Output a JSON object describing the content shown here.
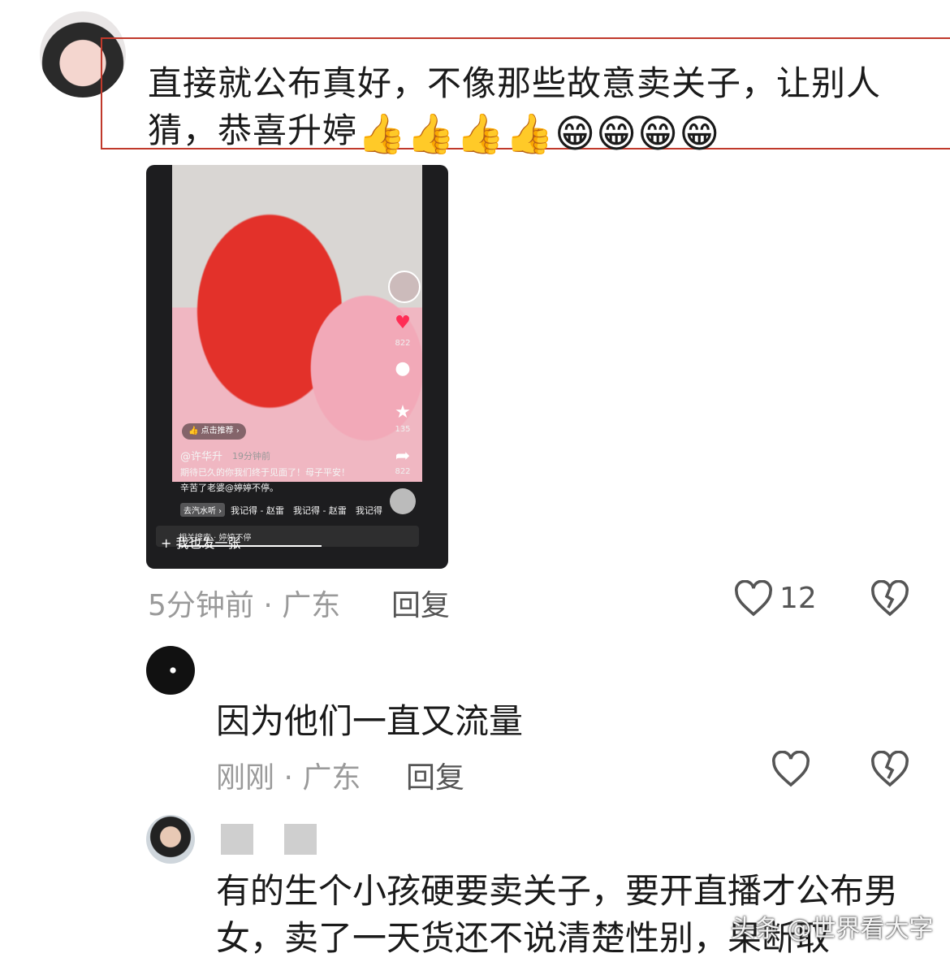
{
  "comments": [
    {
      "text": "直接就公布真好，不像那些故意卖关子，让别人猜，恭喜升婷",
      "emojis": "👍👍👍👍😁😁😁😁",
      "time_location": "5分钟前 · 广东",
      "reply_label": "回复",
      "like_count": "12"
    },
    {
      "text": "因为他们一直又流量",
      "time_location": "刚刚 · 广东",
      "reply_label": "回复"
    },
    {
      "text": "有的生个小孩硬要卖关子，要开直播才公布男女，卖了一天货还不说清楚性别，果断取"
    }
  ],
  "embedded_video": {
    "recommend_pill": "点击推荐 ›",
    "author": "@许华升",
    "post_time": "19分钟前",
    "caption_line1": "期待已久的你我们终于见面了！母子平安！",
    "caption_line2": "辛苦了老婆@婷婷不停。",
    "music_tag": "去汽水听 ›",
    "music_line": "我记得 - 赵雷　我记得 - 赵雷　我记得",
    "related": "相关搜索 · 婷婷不停",
    "add_label": "+ 我也发一张",
    "side_counts": [
      "",
      "822",
      "135",
      "822"
    ]
  },
  "watermark": "头条 @世界看大字",
  "colors": {
    "highlight_border": "#c0392b",
    "meta_gray": "#9a9a9a",
    "reply_gray": "#555555"
  }
}
